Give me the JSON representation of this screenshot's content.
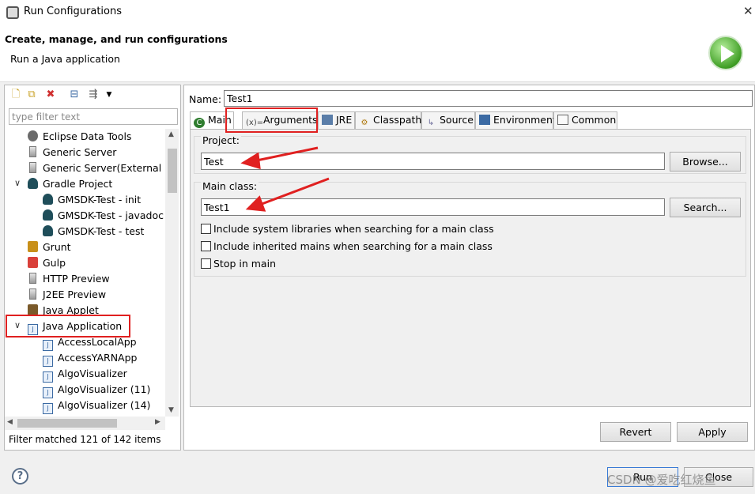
{
  "window": {
    "title": "Run Configurations",
    "icon": "run-configurations-icon"
  },
  "header": {
    "title": "Create, manage, and run configurations",
    "subtitle": "Run a Java application",
    "icon": "run-large-icon"
  },
  "left": {
    "toolbar_icons": [
      "new-config-icon",
      "duplicate-icon",
      "delete-icon",
      "collapse-all-icon",
      "filter-icon",
      "dropdown-arrow-icon"
    ],
    "filter_placeholder": "type filter text",
    "tree": [
      {
        "label": "Eclipse Data Tools",
        "icon": "gear-icon",
        "level": 1,
        "expanded": null
      },
      {
        "label": "Generic Server",
        "icon": "server-icon",
        "level": 1,
        "expanded": null
      },
      {
        "label": "Generic Server(External La",
        "icon": "server-icon",
        "level": 1,
        "expanded": null
      },
      {
        "label": "Gradle Project",
        "icon": "gradle-icon",
        "level": 1,
        "expanded": true
      },
      {
        "label": "GMSDK-Test - init",
        "icon": "gradle-icon",
        "level": 2,
        "expanded": null
      },
      {
        "label": "GMSDK-Test - javadoc",
        "icon": "gradle-icon",
        "level": 2,
        "expanded": null
      },
      {
        "label": "GMSDK-Test - test",
        "icon": "gradle-icon",
        "level": 2,
        "expanded": null
      },
      {
        "label": "Grunt",
        "icon": "grunt-icon",
        "level": 1,
        "expanded": null
      },
      {
        "label": "Gulp",
        "icon": "gulp-icon",
        "level": 1,
        "expanded": null
      },
      {
        "label": "HTTP Preview",
        "icon": "server-icon",
        "level": 1,
        "expanded": null
      },
      {
        "label": "J2EE Preview",
        "icon": "server-icon",
        "level": 1,
        "expanded": null
      },
      {
        "label": "Java Applet",
        "icon": "applet-icon",
        "level": 1,
        "expanded": null
      },
      {
        "label": "Java Application",
        "icon": "java-app-icon",
        "level": 1,
        "expanded": true
      },
      {
        "label": "AccessLocalApp",
        "icon": "java-app-icon",
        "level": 2,
        "expanded": null
      },
      {
        "label": "AccessYARNApp",
        "icon": "java-app-icon",
        "level": 2,
        "expanded": null
      },
      {
        "label": "AlgoVisualizer",
        "icon": "java-app-icon",
        "level": 2,
        "expanded": null
      },
      {
        "label": "AlgoVisualizer (11)",
        "icon": "java-app-icon",
        "level": 2,
        "expanded": null
      },
      {
        "label": "AlgoVisualizer (14)",
        "icon": "java-app-icon",
        "level": 2,
        "expanded": null
      }
    ],
    "status": "Filter matched 121 of 142 items"
  },
  "right": {
    "name_label": "Name:",
    "name_value": "Test1",
    "tabs": [
      {
        "label": "Main",
        "icon": "main-tab-icon",
        "active": true
      },
      {
        "label": "Arguments",
        "icon": "arguments-icon",
        "active": false
      },
      {
        "label": "JRE",
        "icon": "jre-icon",
        "active": false
      },
      {
        "label": "Classpath",
        "icon": "classpath-icon",
        "active": false
      },
      {
        "label": "Source",
        "icon": "source-icon",
        "active": false
      },
      {
        "label": "Environment",
        "icon": "environment-icon",
        "active": false
      },
      {
        "label": "Common",
        "icon": "common-icon",
        "active": false
      }
    ],
    "project": {
      "label": "Project:",
      "value": "Test",
      "button": "Browse..."
    },
    "main_class": {
      "label": "Main class:",
      "value": "Test1",
      "button": "Search..."
    },
    "checkboxes": [
      {
        "label": "Include system libraries when searching for a main class",
        "checked": false
      },
      {
        "label": "Include inherited mains when searching for a main class",
        "checked": false
      },
      {
        "label": "Stop in main",
        "checked": false
      }
    ],
    "revert": "Revert",
    "apply": "Apply"
  },
  "footer": {
    "run": "Run",
    "close": "Close",
    "help_icon": "help-icon"
  },
  "watermark": "CSDN @爱吃红烧鱼",
  "colors": {
    "annotation_red": "#e02020",
    "run_green": "#3f9e25"
  }
}
